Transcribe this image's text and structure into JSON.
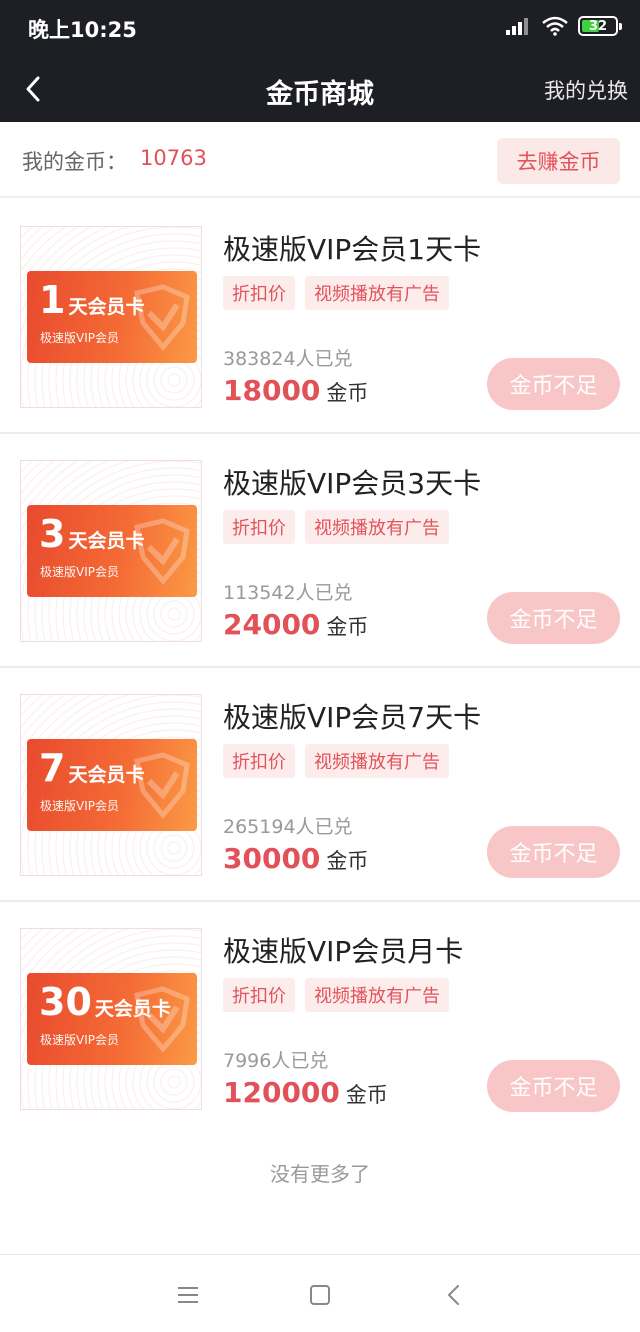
{
  "status_bar": {
    "time": "晚上10:25",
    "battery": "32"
  },
  "nav": {
    "title": "金币商城",
    "right_label": "我的兑换"
  },
  "coins": {
    "label": "我的金币：",
    "value": "10763",
    "earn_button": "去赚金币"
  },
  "products": [
    {
      "badge_number": "1",
      "badge_unit": "天会员卡",
      "badge_sub": "极速版VIP会员",
      "title": "极速版VIP会员1天卡",
      "tags": [
        "折扣价",
        "视频播放有广告"
      ],
      "sold": "383824人已兑",
      "price": "18000",
      "price_unit": "金币",
      "button": "金币不足"
    },
    {
      "badge_number": "3",
      "badge_unit": "天会员卡",
      "badge_sub": "极速版VIP会员",
      "title": "极速版VIP会员3天卡",
      "tags": [
        "折扣价",
        "视频播放有广告"
      ],
      "sold": "113542人已兑",
      "price": "24000",
      "price_unit": "金币",
      "button": "金币不足"
    },
    {
      "badge_number": "7",
      "badge_unit": "天会员卡",
      "badge_sub": "极速版VIP会员",
      "title": "极速版VIP会员7天卡",
      "tags": [
        "折扣价",
        "视频播放有广告"
      ],
      "sold": "265194人已兑",
      "price": "30000",
      "price_unit": "金币",
      "button": "金币不足"
    },
    {
      "badge_number": "30",
      "badge_unit": "天会员卡",
      "badge_sub": "极速版VIP会员",
      "title": "极速版VIP会员月卡",
      "tags": [
        "折扣价",
        "视频播放有广告"
      ],
      "sold": "7996人已兑",
      "price": "120000",
      "price_unit": "金币",
      "button": "金币不足"
    }
  ],
  "footer_text": "没有更多了",
  "icons": {
    "back": "chevron-left-icon",
    "signal": "signal-icon",
    "wifi": "wifi-icon",
    "battery": "battery-icon",
    "menu": "menu-icon",
    "home": "home-square-icon",
    "sys_back": "back-triangle-icon"
  },
  "colors": {
    "accent": "#e25058",
    "header_bg": "#1d1f24",
    "tag_bg": "#fdecec",
    "disabled_button": "#f8c6c6"
  }
}
